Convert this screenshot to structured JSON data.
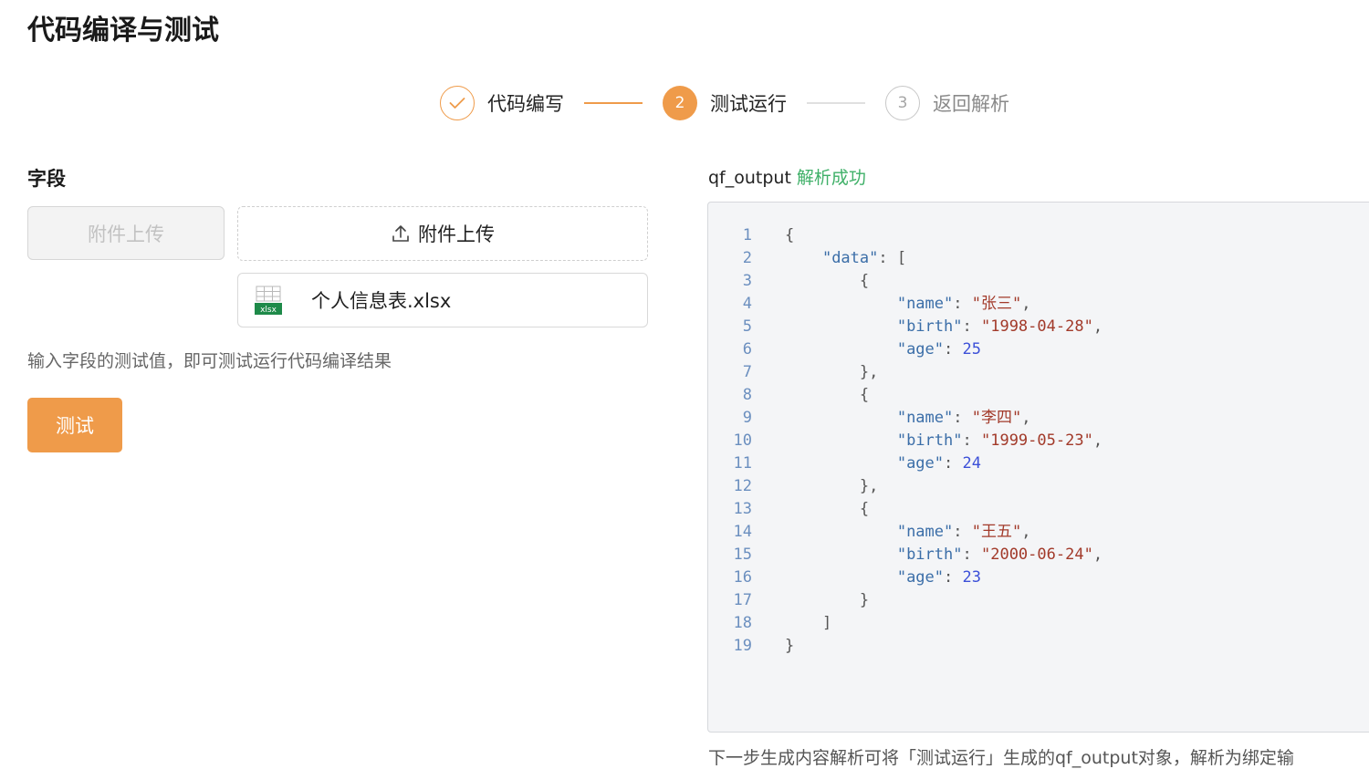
{
  "page": {
    "title": "代码编译与测试"
  },
  "steps": [
    {
      "index": "✓",
      "label": "代码编写",
      "state": "done"
    },
    {
      "index": "2",
      "label": "测试运行",
      "state": "active"
    },
    {
      "index": "3",
      "label": "返回解析",
      "state": "wait"
    }
  ],
  "left": {
    "field_label": "字段",
    "disabled_button": "附件上传",
    "upload_label": "附件上传",
    "file": {
      "icon_text": "xlsx",
      "name": "个人信息表.xlsx"
    },
    "hint": "输入字段的测试值，即可测试运行代码编译结果",
    "test_button": "测试"
  },
  "right": {
    "output_name": "qf_output",
    "output_status": "解析成功",
    "code": [
      "{",
      "    \"data\": [",
      "        {",
      "            \"name\": \"张三\",",
      "            \"birth\": \"1998-04-28\",",
      "            \"age\": 25",
      "        },",
      "        {",
      "            \"name\": \"李四\",",
      "            \"birth\": \"1999-05-23\",",
      "            \"age\": 24",
      "        },",
      "        {",
      "            \"name\": \"王五\",",
      "            \"birth\": \"2000-06-24\",",
      "            \"age\": 23",
      "        }",
      "    ]",
      "}"
    ],
    "footer_note": "下一步生成内容解析可将「测试运行」生成的qf_output对象，解析为绑定输"
  },
  "colors": {
    "accent": "#ef9b4a",
    "success": "#3fb068",
    "code_bg": "#f4f5f7"
  }
}
